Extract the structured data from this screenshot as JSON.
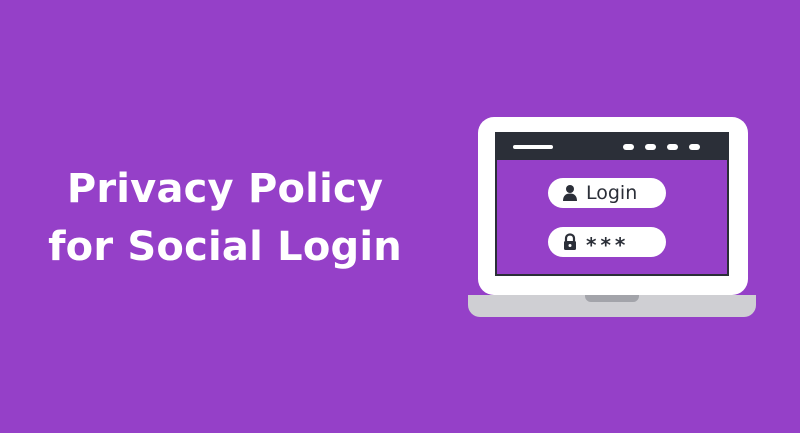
{
  "headline": {
    "line1": "Privacy Policy",
    "line2": "for Social Login"
  },
  "colors": {
    "background": "#9540c8",
    "laptop_frame": "#ffffff",
    "browser_bar": "#2b2f38",
    "laptop_base": "#cfcfd3"
  },
  "login_form": {
    "username_field": {
      "icon": "user-icon",
      "label": "Login"
    },
    "password_field": {
      "icon": "lock-icon",
      "masked_value": "***"
    }
  }
}
